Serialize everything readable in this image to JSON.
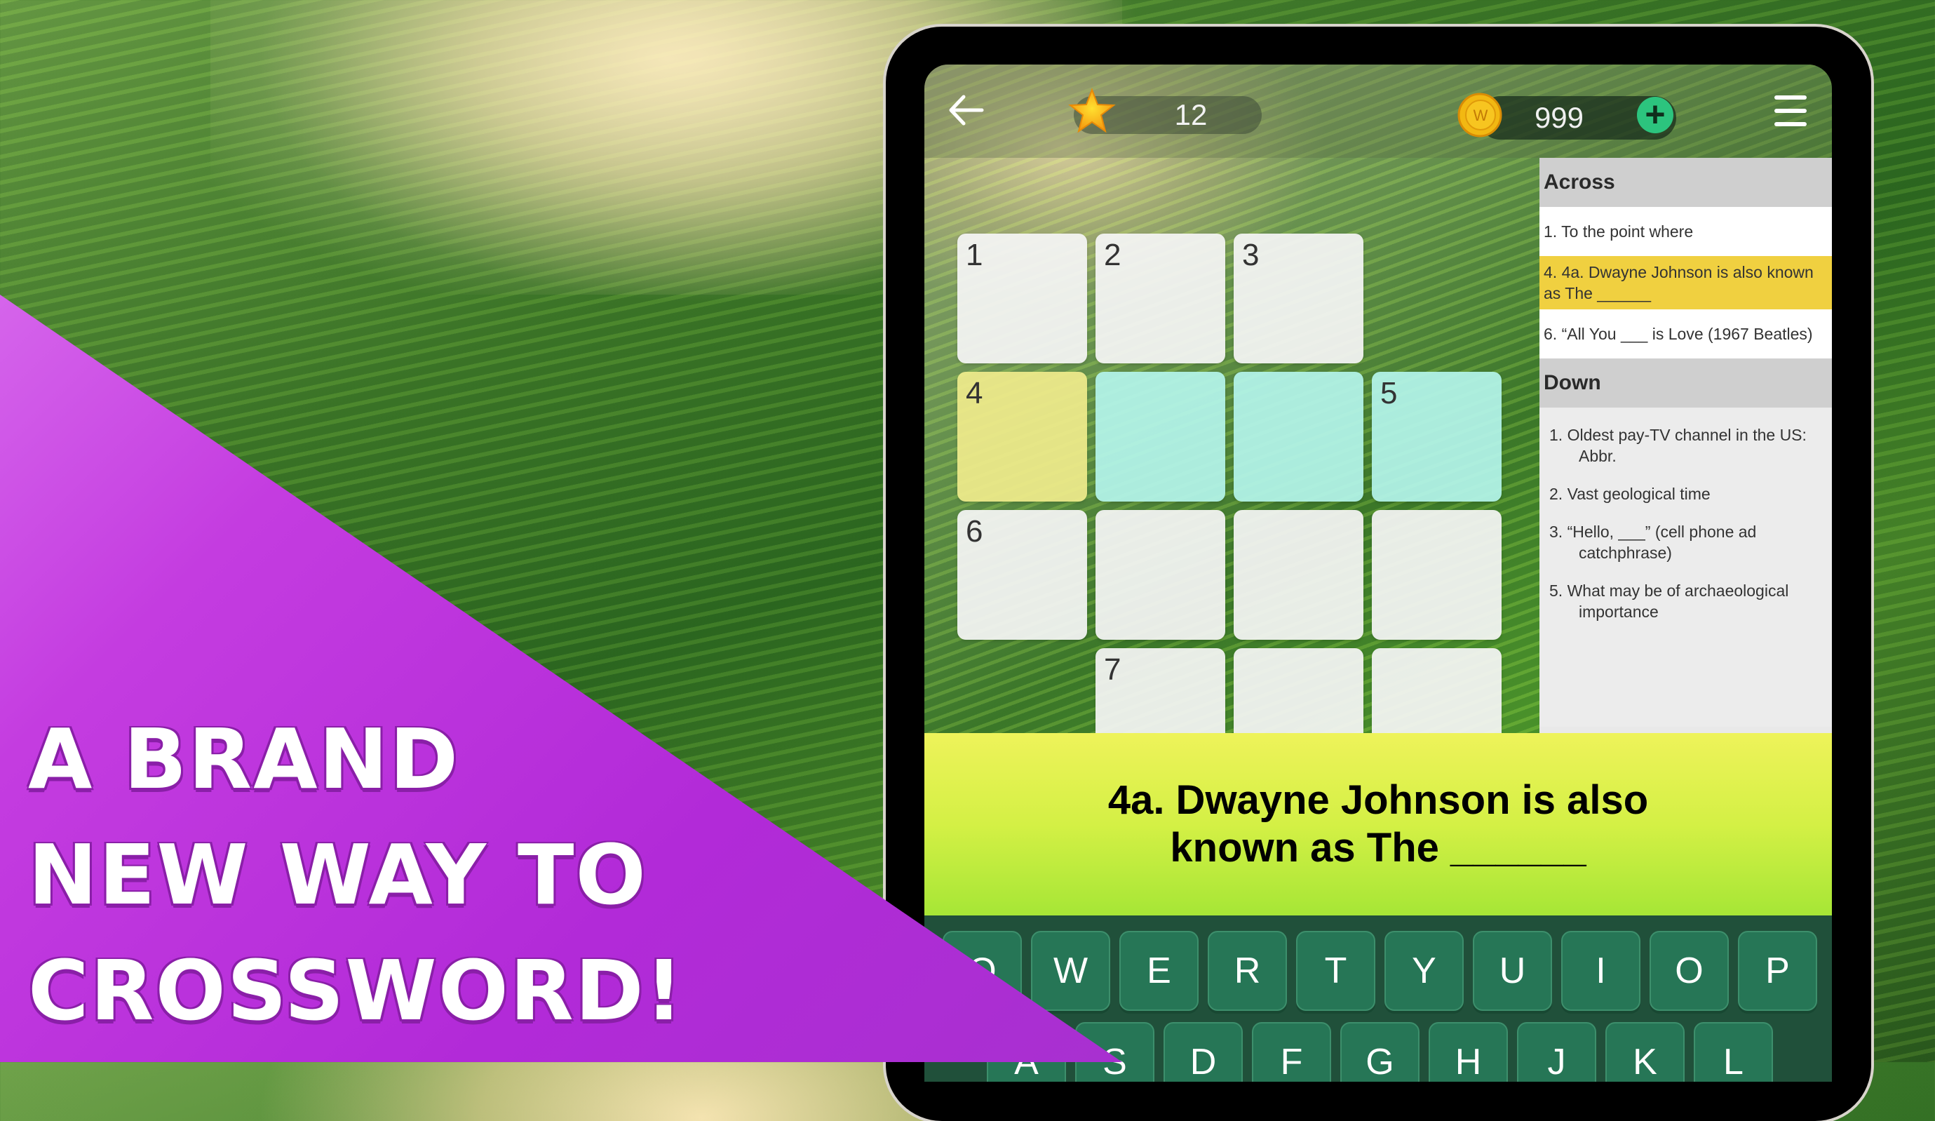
{
  "promo": {
    "lines": [
      "A BRAND",
      "NEW WAY TO",
      "CROSSWORD!"
    ]
  },
  "topbar": {
    "back_icon": "arrow-left-icon",
    "stars": "12",
    "coins": "999",
    "add_coins_label": "+",
    "menu_icon": "hamburger-menu-icon"
  },
  "grid": {
    "cells": [
      {
        "row": 0,
        "col": 0,
        "number": "1",
        "state": "empty"
      },
      {
        "row": 0,
        "col": 1,
        "number": "2",
        "state": "empty"
      },
      {
        "row": 0,
        "col": 2,
        "number": "3",
        "state": "empty"
      },
      {
        "row": 1,
        "col": 0,
        "number": "4",
        "state": "selected"
      },
      {
        "row": 1,
        "col": 1,
        "number": "",
        "state": "word"
      },
      {
        "row": 1,
        "col": 2,
        "number": "",
        "state": "word"
      },
      {
        "row": 1,
        "col": 3,
        "number": "5",
        "state": "word"
      },
      {
        "row": 2,
        "col": 0,
        "number": "6",
        "state": "empty"
      },
      {
        "row": 2,
        "col": 1,
        "number": "",
        "state": "empty"
      },
      {
        "row": 2,
        "col": 2,
        "number": "",
        "state": "empty"
      },
      {
        "row": 2,
        "col": 3,
        "number": "",
        "state": "empty"
      },
      {
        "row": 3,
        "col": 1,
        "number": "7",
        "state": "empty"
      },
      {
        "row": 3,
        "col": 2,
        "number": "",
        "state": "empty"
      },
      {
        "row": 3,
        "col": 3,
        "number": "",
        "state": "empty"
      }
    ]
  },
  "clues": {
    "across_title": "Across",
    "across": [
      {
        "text": "1. To the point where",
        "active": false
      },
      {
        "text": "4. 4a. Dwayne Johnson is also known as The ______",
        "active": true
      },
      {
        "text": "6. “All You ___ is Love (1967 Beatles)",
        "active": false
      }
    ],
    "down_title": "Down",
    "down": [
      {
        "num": "1.",
        "text": "Oldest pay-TV channel in the US:",
        "cont": "Abbr."
      },
      {
        "num": "2.",
        "text": "Vast geological time",
        "cont": ""
      },
      {
        "num": "3.",
        "text": "“Hello, ___” (cell phone ad",
        "cont": "catchphrase)"
      },
      {
        "num": "5.",
        "text": "What may be of archaeological",
        "cont": "importance"
      }
    ]
  },
  "banner": {
    "line1": "4a. Dwayne Johnson is also",
    "line2": "known as The ______"
  },
  "keyboard": {
    "row1": [
      "Q",
      "W",
      "E",
      "R",
      "T",
      "Y",
      "U",
      "I",
      "O",
      "P"
    ],
    "row2": [
      "A",
      "S",
      "D",
      "F",
      "G",
      "H",
      "J",
      "K",
      "L"
    ]
  },
  "colors": {
    "selected_cell": "#f0eb8c",
    "word_cell": "#b4f5eb",
    "active_clue": "#f0d040",
    "key": "#267656",
    "promo": "#b22ad8",
    "plus": "#2cc47e"
  }
}
